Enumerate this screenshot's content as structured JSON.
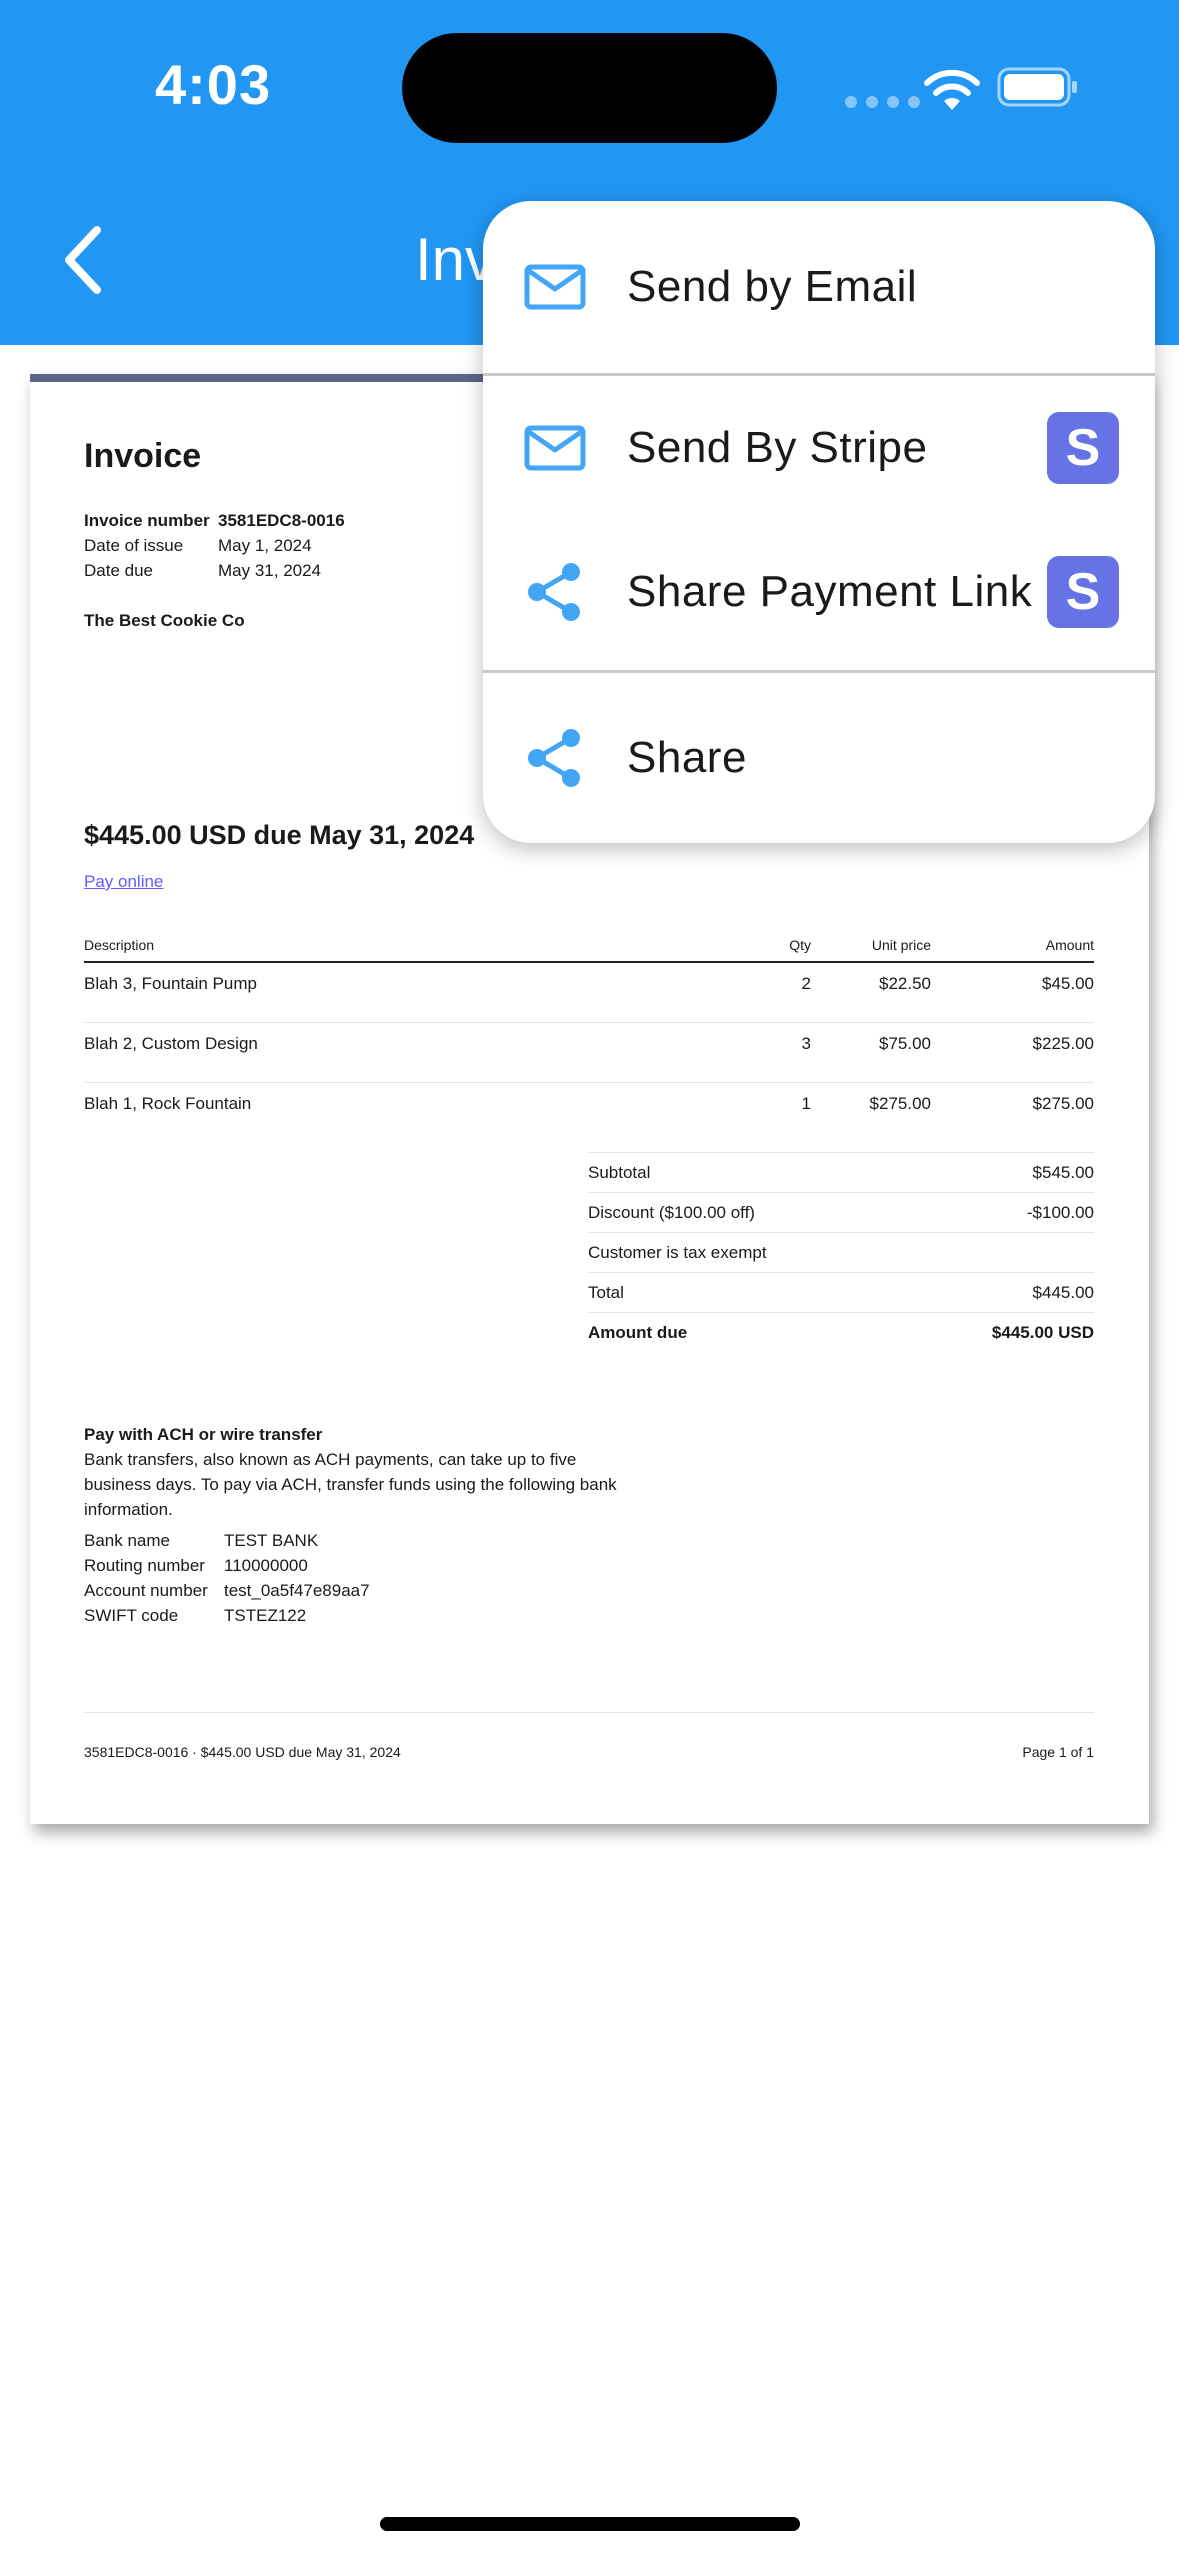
{
  "status_bar": {
    "time": "4:03"
  },
  "nav": {
    "title_partial": "Inv"
  },
  "invoice": {
    "title": "Invoice",
    "meta": [
      {
        "label": "Invoice number",
        "value": "3581EDC8-0016"
      },
      {
        "label": "Date of issue",
        "value": "May 1, 2024"
      },
      {
        "label": "Date due",
        "value": "May 31, 2024"
      }
    ],
    "company": "The Best Cookie Co",
    "due_heading": "$445.00 USD due May 31, 2024",
    "pay_online": "Pay online",
    "table": {
      "headers": {
        "desc": "Description",
        "qty": "Qty",
        "unit": "Unit price",
        "amount": "Amount"
      },
      "rows": [
        {
          "desc": "Blah 3, Fountain Pump",
          "qty": "2",
          "unit": "$22.50",
          "amount": "$45.00"
        },
        {
          "desc": "Blah 2, Custom Design",
          "qty": "3",
          "unit": "$75.00",
          "amount": "$225.00"
        },
        {
          "desc": "Blah 1, Rock Fountain",
          "qty": "1",
          "unit": "$275.00",
          "amount": "$275.00"
        }
      ]
    },
    "totals": [
      {
        "label": "Subtotal",
        "value": "$545.00"
      },
      {
        "label": "Discount ($100.00 off)",
        "value": "-$100.00"
      },
      {
        "label": "Customer is tax exempt",
        "value": ""
      },
      {
        "label": "Total",
        "value": "$445.00"
      },
      {
        "label": "Amount due",
        "value": "$445.00 USD"
      }
    ],
    "ach": {
      "heading": "Pay with ACH or wire transfer",
      "body": "Bank transfers, also known as ACH payments, can take up to five business days. To pay via ACH, transfer funds using the following bank information.",
      "bank": [
        {
          "label": "Bank name",
          "value": "TEST BANK"
        },
        {
          "label": "Routing number",
          "value": "110000000"
        },
        {
          "label": "Account number",
          "value": "test_0a5f47e89aa7"
        },
        {
          "label": "SWIFT code",
          "value": "TSTEZ122"
        }
      ]
    },
    "footer": {
      "left": "3581EDC8-0016 · $445.00 USD due May 31, 2024",
      "right": "Page 1 of 1"
    }
  },
  "menu": {
    "items": [
      {
        "label": "Send by Email",
        "icon": "mail-icon"
      },
      {
        "label": "Send By Stripe",
        "icon": "mail-icon",
        "badge": "S"
      },
      {
        "label": "Share Payment Link",
        "icon": "share-icon",
        "badge": "S"
      },
      {
        "label": "Share",
        "icon": "share-icon"
      }
    ]
  },
  "colors": {
    "header": "#2196f3",
    "icon": "#42a5f5",
    "stripe": "#6772e5",
    "doc_border": "#5b6689"
  }
}
